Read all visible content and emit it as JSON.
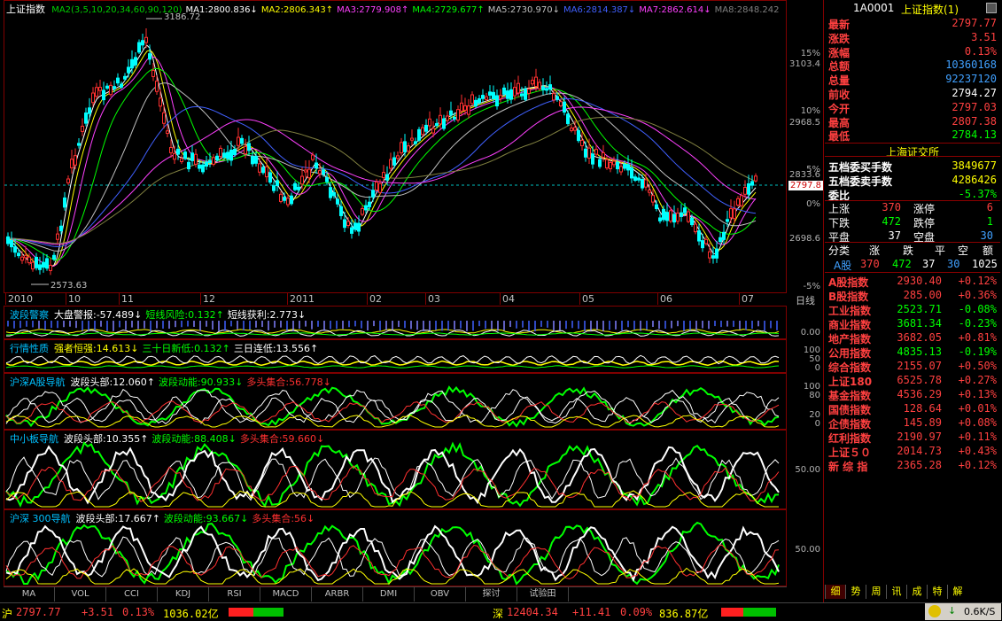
{
  "main": {
    "title": "上证指数",
    "ma_header": [
      {
        "label": "MA2(3,5,10,20,34,60,90,120)",
        "color": "#00d000"
      },
      {
        "label": "MA1:2800.836↓",
        "color": "#ffffff"
      },
      {
        "label": "MA2:2806.343↑",
        "color": "#ffff00"
      },
      {
        "label": "MA3:2779.908↑",
        "color": "#ff40ff"
      },
      {
        "label": "MA4:2729.677↑",
        "color": "#00ff00"
      },
      {
        "label": "MA5:2730.970↓",
        "color": "#c0c0c0"
      },
      {
        "label": "MA6:2814.387↓",
        "color": "#4060ff"
      },
      {
        "label": "MA7:2862.614↓",
        "color": "#ff40ff"
      },
      {
        "label": "MA8:2848.242",
        "color": "#808080"
      }
    ],
    "high_label": "3186.72",
    "low_label": "2573.63",
    "current_tag": "2797.8",
    "y_prices": [
      "3103.4",
      "2968.5",
      "2833.6",
      "2698.6"
    ],
    "y_pcts": [
      "15%",
      "10%",
      "5%",
      "0%",
      "-5%"
    ],
    "x_labels": [
      "2010",
      "10",
      "11",
      "12",
      "2011",
      "02",
      "03",
      "04",
      "05",
      "06",
      "07"
    ],
    "period": "日线"
  },
  "indicators": [
    {
      "name": "波段警察",
      "parts": [
        {
          "t": "大盘警报:-57.489↓",
          "c": "#ffffff"
        },
        {
          "t": "短线风险:0.132↑",
          "c": "#00ff00"
        },
        {
          "t": "短线获利:2.773↓",
          "c": "#ffffff"
        }
      ],
      "y": [
        "0.00"
      ]
    },
    {
      "name": "行情性质",
      "parts": [
        {
          "t": "强者恒强:14.613↓",
          "c": "#ffff00"
        },
        {
          "t": "三十日新低:0.132↑",
          "c": "#00ff00"
        },
        {
          "t": "三日连低:13.556↑",
          "c": "#ffffff"
        }
      ],
      "y": [
        "100",
        "50",
        "0"
      ]
    },
    {
      "name": "沪深A股导航",
      "parts": [
        {
          "t": "波段头部:12.060↑",
          "c": "#ffffff"
        },
        {
          "t": "波段动能:90.933↓",
          "c": "#00ff00"
        },
        {
          "t": "多头集合:56.778↓",
          "c": "#ff3030"
        }
      ],
      "y": [
        "100",
        "80",
        "20",
        "0"
      ]
    },
    {
      "name": "中小板导航",
      "parts": [
        {
          "t": "波段头部:10.355↑",
          "c": "#ffffff"
        },
        {
          "t": "波段动能:88.408↓",
          "c": "#00ff00"
        },
        {
          "t": "多头集合:59.660↓",
          "c": "#ff3030"
        }
      ],
      "y": [
        "50.00"
      ]
    },
    {
      "name": "沪深 300导航",
      "parts": [
        {
          "t": "波段头部:17.667↑",
          "c": "#ffffff"
        },
        {
          "t": "波段动能:93.667↓",
          "c": "#00ff00"
        },
        {
          "t": "多头集合:56↓",
          "c": "#ff3030"
        }
      ],
      "y": [
        "50.00"
      ]
    }
  ],
  "buttons": [
    "MA",
    "VOL",
    "CCI",
    "KDJ",
    "RSI",
    "MACD",
    "ARBR",
    "DMI",
    "OBV",
    "探讨",
    "试验田"
  ],
  "quote": {
    "code": "1A0001",
    "name": "上证指数(1)",
    "rows": [
      {
        "k": "最新",
        "v": "2797.77",
        "c": "#ff4040"
      },
      {
        "k": "涨跌",
        "v": "3.51",
        "c": "#ff4040"
      },
      {
        "k": "涨幅",
        "v": "0.13%",
        "c": "#ff4040"
      },
      {
        "k": "总额",
        "v": "10360168",
        "c": "#40a0ff"
      },
      {
        "k": "总量",
        "v": "92237120",
        "c": "#40a0ff"
      },
      {
        "k": "前收",
        "v": "2794.27",
        "c": "#ffffff"
      },
      {
        "k": "今开",
        "v": "2797.03",
        "c": "#ff4040"
      },
      {
        "k": "最高",
        "v": "2807.38",
        "c": "#ff4040"
      },
      {
        "k": "最低",
        "v": "2784.13",
        "c": "#00ff00"
      }
    ],
    "exchange": "上海证交所",
    "orders": [
      {
        "k": "五档委买手数",
        "v": "3849677",
        "c": "#ffff00"
      },
      {
        "k": "五档委卖手数",
        "v": "4286426",
        "c": "#ffff00"
      },
      {
        "k": "委比",
        "v": "-5.37%",
        "c": "#00ff00"
      }
    ],
    "breadth": [
      {
        "a": "上涨",
        "av": "370",
        "ac": "#ff4040",
        "b": "涨停",
        "bv": "6",
        "bc": "#ff4040"
      },
      {
        "a": "下跌",
        "av": "472",
        "ac": "#00ff00",
        "b": "跌停",
        "bv": "1",
        "bc": "#00ff00"
      },
      {
        "a": "平盘",
        "av": "37",
        "ac": "#ffffff",
        "b": "空盘",
        "bv": "30",
        "bc": "#40a0ff"
      }
    ],
    "cat_header": [
      "分类",
      "涨",
      "跌",
      "平",
      "空",
      "额"
    ],
    "cat_row": {
      "k": "A股",
      "v": [
        "370",
        "472",
        "37",
        "30",
        "1025"
      ]
    },
    "indices": [
      {
        "k": "A股指数",
        "p": "2930.40",
        "c": "+0.12%",
        "col": "#ff4040"
      },
      {
        "k": "B股指数",
        "p": "285.00",
        "c": "+0.36%",
        "col": "#ff4040"
      },
      {
        "k": "工业指数",
        "p": "2523.71",
        "c": "-0.08%",
        "col": "#00ff00"
      },
      {
        "k": "商业指数",
        "p": "3681.34",
        "c": "-0.23%",
        "col": "#00ff00"
      },
      {
        "k": "地产指数",
        "p": "3682.05",
        "c": "+0.81%",
        "col": "#ff4040"
      },
      {
        "k": "公用指数",
        "p": "4835.13",
        "c": "-0.19%",
        "col": "#00ff00"
      },
      {
        "k": "综合指数",
        "p": "2155.07",
        "c": "+0.50%",
        "col": "#ff4040"
      },
      {
        "k": "上证180",
        "p": "6525.78",
        "c": "+0.27%",
        "col": "#ff4040"
      },
      {
        "k": "基金指数",
        "p": "4536.29",
        "c": "+0.13%",
        "col": "#ff4040"
      },
      {
        "k": "国债指数",
        "p": "128.64",
        "c": "+0.01%",
        "col": "#ff4040"
      },
      {
        "k": "企债指数",
        "p": "145.89",
        "c": "+0.08%",
        "col": "#ff4040"
      },
      {
        "k": "红利指数",
        "p": "2190.97",
        "c": "+0.11%",
        "col": "#ff4040"
      },
      {
        "k": "上证５０",
        "p": "2014.73",
        "c": "+0.43%",
        "col": "#ff4040"
      },
      {
        "k": "新 综 指",
        "p": "2365.28",
        "c": "+0.12%",
        "col": "#ff4040"
      }
    ],
    "tabs": [
      "细",
      "势",
      "周",
      "讯",
      "成",
      "特",
      "解"
    ]
  },
  "status": {
    "sh": {
      "label": "沪",
      "price": "2797.77",
      "chg": "+3.51",
      "pct": "0.13%",
      "amt": "1036.02亿"
    },
    "sz": {
      "label": "深",
      "price": "12404.34",
      "chg": "+11.41",
      "pct": "0.09%",
      "amt": "836.87亿"
    },
    "speed": "0.6K/S"
  },
  "colors": {
    "up": "#ff4040",
    "down": "#00ff00",
    "frame": "#800000",
    "accent": "#ffff00"
  }
}
